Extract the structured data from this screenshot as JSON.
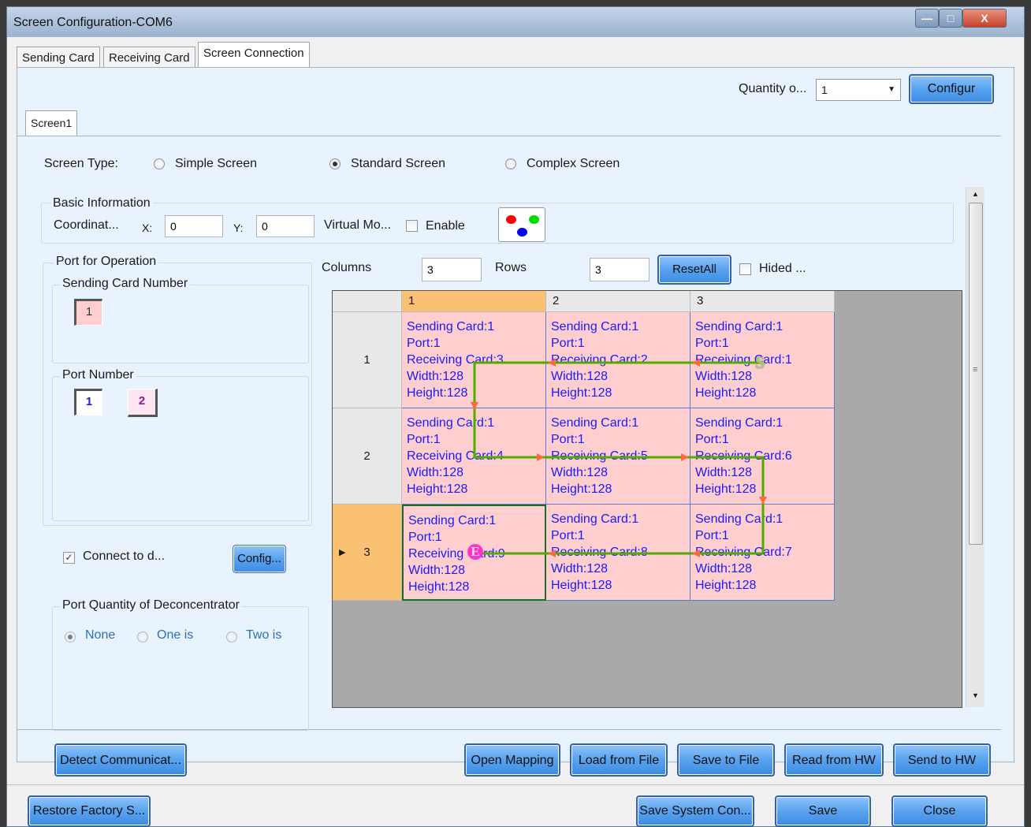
{
  "window": {
    "title": "Screen Configuration-COM6"
  },
  "tabs": [
    {
      "label": "Sending Card"
    },
    {
      "label": "Receiving Card"
    },
    {
      "label": "Screen Connection"
    }
  ],
  "quantity": {
    "label": "Quantity o...",
    "value": "1",
    "button": "Configur"
  },
  "screen_tab": "Screen1",
  "screen_type": {
    "label": "Screen Type:",
    "options": [
      "Simple Screen",
      "Standard Screen",
      "Complex Screen"
    ],
    "selected": "Standard Screen"
  },
  "basic_info": {
    "title": "Basic Information",
    "coord_label": "Coordinat...",
    "x_label": "X:",
    "x_value": "0",
    "y_label": "Y:",
    "y_value": "0",
    "virtual_label": "Virtual Mo...",
    "enable_label": "Enable"
  },
  "port_op": {
    "title": "Port for Operation",
    "sending_card_title": "Sending Card Number",
    "sending_cards": [
      "1"
    ],
    "port_number_title": "Port Number",
    "ports": [
      "1",
      "2"
    ]
  },
  "connect": {
    "label": "Connect to d...",
    "checked": true,
    "button": "Config..."
  },
  "deconcentrator": {
    "title": "Port Quantity of Deconcentrator",
    "options": [
      "None",
      "One is",
      "Two is"
    ],
    "selected": "None"
  },
  "grid_controls": {
    "columns_label": "Columns",
    "columns_value": "3",
    "rows_label": "Rows",
    "rows_value": "3",
    "reset_button": "ResetAll",
    "hided_label": "Hided ..."
  },
  "grid": {
    "col_headers": [
      "1",
      "2",
      "3"
    ],
    "row_headers": [
      "1",
      "2",
      "3"
    ],
    "cells": [
      [
        {
          "l1": "Sending Card:1",
          "l2": "Port:1",
          "l3": "Receiving Card:3",
          "l4": "Width:128",
          "l5": "Height:128"
        },
        {
          "l1": "Sending Card:1",
          "l2": "Port:1",
          "l3": "Receiving Card:2",
          "l4": "Width:128",
          "l5": "Height:128"
        },
        {
          "l1": "Sending Card:1",
          "l2": "Port:1",
          "l3": "Receiving Card:1",
          "l4": "Width:128",
          "l5": "Height:128"
        }
      ],
      [
        {
          "l1": "Sending Card:1",
          "l2": "Port:1",
          "l3": "Receiving Card:4",
          "l4": "Width:128",
          "l5": "Height:128"
        },
        {
          "l1": "Sending Card:1",
          "l2": "Port:1",
          "l3": "Receiving Card:5",
          "l4": "Width:128",
          "l5": "Height:128"
        },
        {
          "l1": "Sending Card:1",
          "l2": "Port:1",
          "l3": "Receiving Card:6",
          "l4": "Width:128",
          "l5": "Height:128"
        }
      ],
      [
        {
          "l1": "Sending Card:1",
          "l2": "Port:1",
          "l3": "Receiving Card:9",
          "l4": "Width:128",
          "l5": "Height:128"
        },
        {
          "l1": "Sending Card:1",
          "l2": "Port:1",
          "l3": "Receiving Card:8",
          "l4": "Width:128",
          "l5": "Height:128"
        },
        {
          "l1": "Sending Card:1",
          "l2": "Port:1",
          "l3": "Receiving Card:7",
          "l4": "Width:128",
          "l5": "Height:128"
        }
      ]
    ],
    "start_marker": "S",
    "end_marker": "E"
  },
  "bottom_buttons": {
    "detect": "Detect Communicat...",
    "open_mapping": "Open Mapping",
    "load": "Load from File",
    "save_file": "Save to File",
    "read_hw": "Read from HW",
    "send_hw": "Send to HW"
  },
  "footer_buttons": {
    "restore": "Restore Factory S...",
    "save_system": "Save System Con...",
    "save": "Save",
    "close": "Close"
  },
  "colors": {
    "accent": "#3e8be2",
    "cell_bg": "#ffcfcf",
    "path": "#55aa00",
    "arrow": "#ff6a3d"
  }
}
